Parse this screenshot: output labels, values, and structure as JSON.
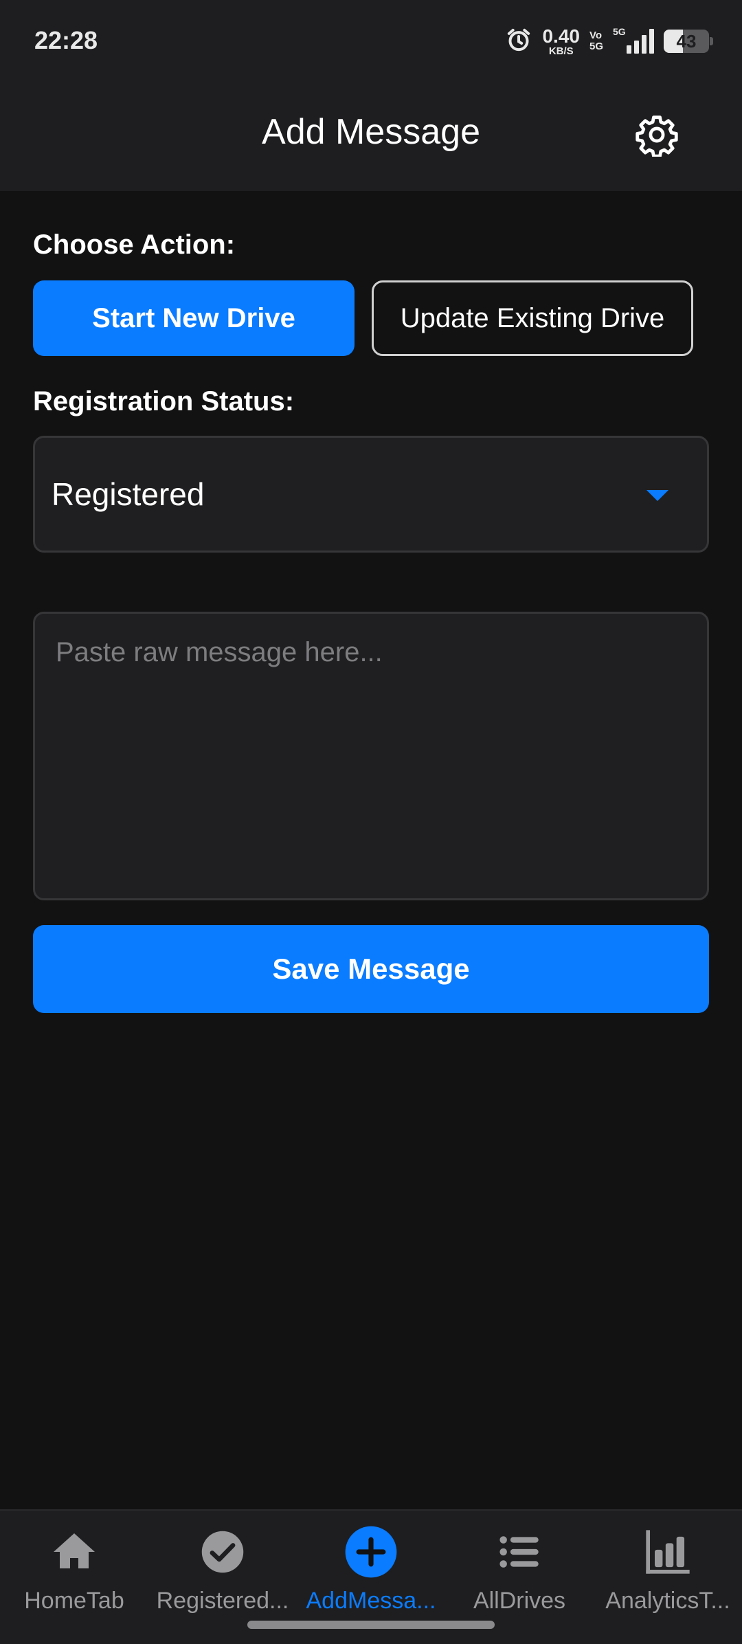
{
  "status_bar": {
    "time": "22:28",
    "net_speed_value": "0.40",
    "net_speed_unit": "KB/S",
    "volte_top": "Vo",
    "volte_bottom": "5G",
    "network_type": "5G",
    "battery_level": "43",
    "icons": [
      "alarm-icon",
      "signal-icon",
      "battery-icon"
    ]
  },
  "header": {
    "title": "Add Message",
    "settings_icon": "gear-icon"
  },
  "form": {
    "choose_action_label": "Choose Action:",
    "actions": [
      {
        "label": "Start New Drive",
        "selected": true
      },
      {
        "label": "Update Existing Drive",
        "selected": false
      }
    ],
    "registration_status_label": "Registration Status:",
    "registration_status_value": "Registered",
    "message_placeholder": "Paste raw message here...",
    "message_value": "",
    "save_label": "Save Message"
  },
  "tabbar": {
    "tabs": [
      {
        "label": "HomeTab",
        "icon": "home-icon",
        "active": false
      },
      {
        "label": "Registered...",
        "icon": "check-circle-icon",
        "active": false
      },
      {
        "label": "AddMessa...",
        "icon": "plus-circle-icon",
        "active": true
      },
      {
        "label": "AllDrives",
        "icon": "list-icon",
        "active": false
      },
      {
        "label": "AnalyticsT...",
        "icon": "bar-chart-icon",
        "active": false
      }
    ]
  },
  "colors": {
    "accent": "#0a7cff",
    "background": "#121213",
    "surface": "#1e1e20",
    "inactive_text": "#9a9a9d"
  }
}
